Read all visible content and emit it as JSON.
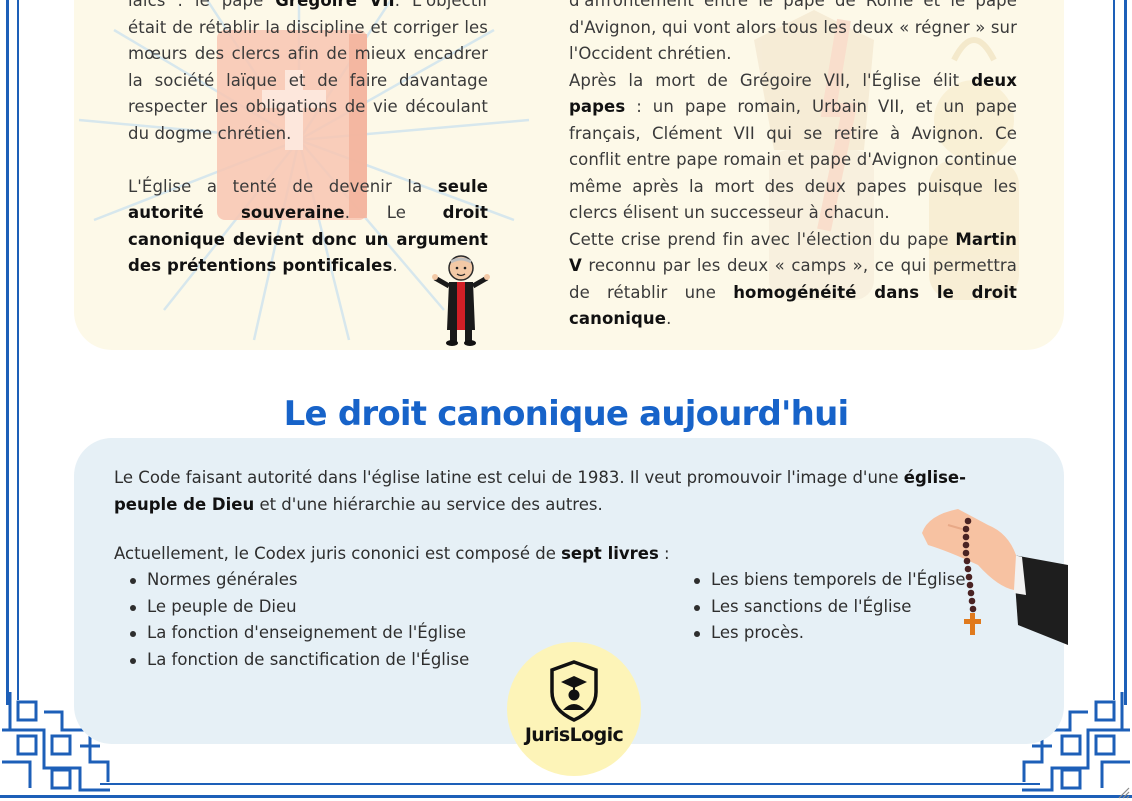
{
  "top_left": {
    "line1": "laïcs : le pape",
    "line1_bold": "Grégoire VII",
    "line1_rest": ". L'objectif",
    "p1": "était de rétablir la discipline et corriger les mœurs des clercs afin de mieux encadrer la société laïque et de faire davantage respecter les obligations de vie découlant du dogme chrétien.",
    "p2_start": "L'Église a tenté de devenir la",
    "p2_bold1": "seule autorité souveraine",
    "p2_mid": ". Le",
    "p2_bold2": "droit canonique devient donc un argument des prétentions pontificales",
    "p2_end": "."
  },
  "top_right": {
    "line1": "d'affrontement entre le pape de Rome et le pape",
    "p1": "d'Avignon, qui vont alors tous les deux « régner » sur l'Occident chrétien.",
    "p2_start": "Après la mort de Grégoire VII, l'Église élit",
    "p2_bold": "deux papes",
    "p2_rest": ": un pape romain, Urbain VII, et un pape français, Clément VII qui se retire à Avignon. Ce conflit entre pape romain et pape d'Avignon continue même après la mort des deux papes puisque les clercs élisent un successeur à chacun.",
    "p3_start": "Cette crise prend fin avec l'élection du pape",
    "p3_bold1": "Martin V",
    "p3_mid": "reconnu par les deux « camps », ce qui permettra de rétablir une",
    "p3_bold2": "homogénéité dans le droit canonique",
    "p3_end": "."
  },
  "section": {
    "title": "Le droit canonique aujourd'hui"
  },
  "bottom": {
    "intro_start": "Le Code faisant autorité dans l'église latine est celui de 1983. Il veut promouvoir l'image d'une",
    "intro_bold": "église-peuple de Dieu",
    "intro_rest": "et d'une hiérarchie au service des autres.",
    "comp_start": "Actuellement, le Codex juris cononici est composé de",
    "comp_bold": "sept livres",
    "comp_end": ":",
    "books_left": [
      "Normes générales",
      "Le peuple de Dieu",
      "La fonction d'enseignement de l'Église",
      "La fonction de sanctification de l'Église"
    ],
    "books_right": [
      "Les biens temporels de l'Église",
      "Les sanctions de l'Église",
      "Les procès."
    ]
  },
  "logo": {
    "name": "JurisLogic"
  },
  "colors": {
    "accent_blue": "#1763c9",
    "frame_blue": "#1d5fb8",
    "cream_panel": "#fdf9e8",
    "blue_panel": "#e6f0f6",
    "logo_yellow": "#fdf4b8"
  },
  "icons": {
    "priest": "priest-figure-icon",
    "rosary_hand": "rosary-hand-icon",
    "graduate_shield": "graduate-shield-icon",
    "bible": "bible-watermark-icon",
    "popes": "popes-watermark-icon"
  }
}
